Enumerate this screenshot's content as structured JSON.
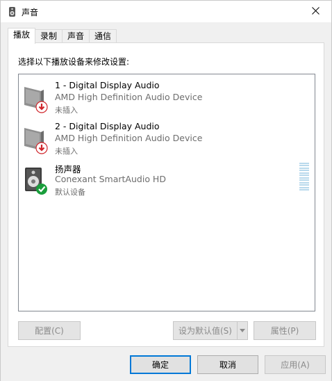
{
  "window": {
    "title": "声音",
    "icon": "speaker-icon",
    "close_icon": "close-icon"
  },
  "tabs": [
    {
      "label": "播放",
      "active": true
    },
    {
      "label": "录制",
      "active": false
    },
    {
      "label": "声音",
      "active": false
    },
    {
      "label": "通信",
      "active": false
    }
  ],
  "instruction": "选择以下播放设备来修改设置:",
  "devices": [
    {
      "name": "1 - Digital Display Audio",
      "description": "AMD High Definition Audio Device",
      "status": "未插入",
      "icon": "monitor-unplugged-icon"
    },
    {
      "name": "2 - Digital Display Audio",
      "description": "AMD High Definition Audio Device",
      "status": "未插入",
      "icon": "monitor-unplugged-icon"
    },
    {
      "name": "扬声器",
      "description": "Conexant SmartAudio HD",
      "status": "默认设备",
      "icon": "speaker-default-icon"
    }
  ],
  "buttons": {
    "configure": "配置(C)",
    "set_default": "设为默认值(S)",
    "properties": "属性(P)",
    "ok": "确定",
    "cancel": "取消",
    "apply": "应用(A)"
  },
  "colors": {
    "accent": "#0078d7",
    "meter": "#b8d9ec",
    "badge_red": "#d0242a",
    "badge_green": "#1a9e3c"
  }
}
